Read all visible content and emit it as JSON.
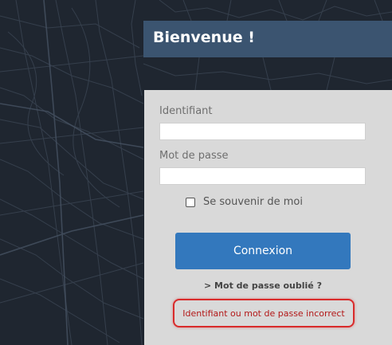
{
  "header": {
    "title": "Bienvenue !"
  },
  "form": {
    "username_label": "Identifiant",
    "username_value": "",
    "password_label": "Mot de passe",
    "password_value": "",
    "remember_label": "Se souvenir de moi",
    "remember_checked": false,
    "login_button": "Connexion",
    "forgot_link": "> Mot de passe oublié ?",
    "error_message": "Identifiant ou mot de passe incorrect"
  },
  "colors": {
    "background": "#1f2630",
    "header": "#3b5470",
    "panel": "#d9d9d9",
    "button": "#3378bd",
    "error": "#d92b2b"
  }
}
